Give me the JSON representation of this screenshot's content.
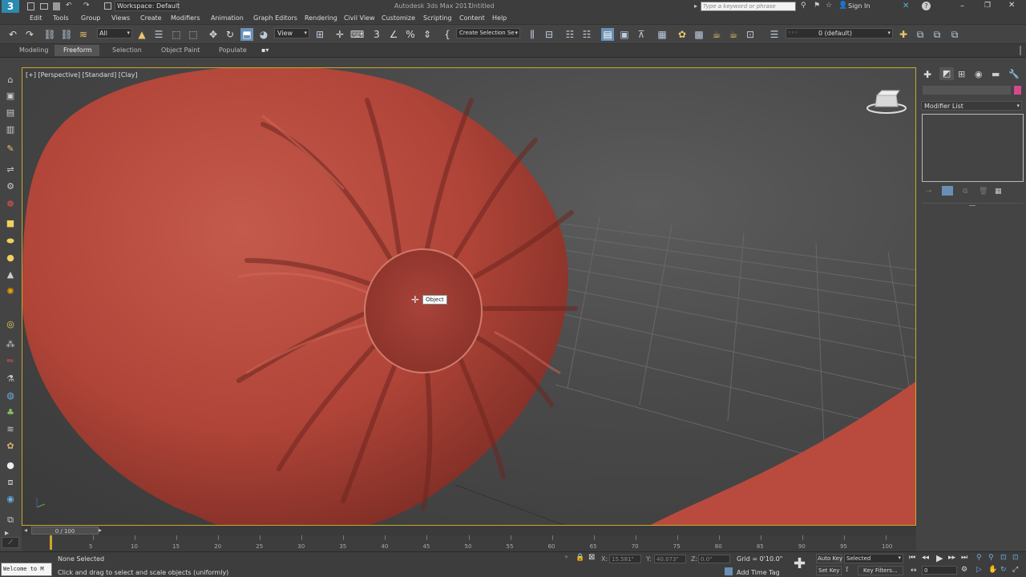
{
  "titlebar": {
    "workspace": "Workspace: Default",
    "app_title": "Autodesk 3ds Max 2017",
    "doc_title": "Untitled",
    "search_placeholder": "Type a keyword or phrase",
    "sign_in": "Sign In"
  },
  "menu": [
    "Edit",
    "Tools",
    "Group",
    "Views",
    "Create",
    "Modifiers",
    "Animation",
    "Graph Editors",
    "Rendering",
    "Civil View",
    "Customize",
    "Scripting",
    "Content",
    "Help"
  ],
  "toolbar": {
    "filter_value": "All",
    "refcoord_value": "View",
    "selection_set_placeholder": "Create Selection Se",
    "layer_value": "0 (default)"
  },
  "ribbon_tabs": [
    "Modeling",
    "Freeform",
    "Selection",
    "Object Paint",
    "Populate"
  ],
  "viewport": {
    "label": "[+] [Perspective] [Standard] [Clay]",
    "tooltip": "Object"
  },
  "command_panel": {
    "modifier_list": "Modifier List",
    "accent_color": "#d34a8c"
  },
  "timeslider": {
    "frame_label": "0 / 100"
  },
  "trackbar": {
    "ticks": [
      "5",
      "10",
      "15",
      "20",
      "25",
      "30",
      "35",
      "40",
      "45",
      "50",
      "55",
      "60",
      "65",
      "70",
      "75",
      "80",
      "85",
      "90",
      "95",
      "100"
    ]
  },
  "status": {
    "maxscript": "Welcome to M",
    "selection": "None Selected",
    "prompt": "Click and drag to select and scale objects (uniformly)",
    "x_label": "X:",
    "x_value": "15.581\"",
    "y_label": "Y:",
    "y_value": "40.073\"",
    "z_label": "Z:",
    "z_value": "0.0\"",
    "grid": "Grid = 0'10.0\"",
    "add_time_tag": "Add Time Tag",
    "auto_key": "Auto Key",
    "set_key": "Set Key",
    "selected": "Selected",
    "key_filters": "Key Filters...",
    "frame": "0"
  },
  "colors": {
    "clay": "#b4473c",
    "viewport_border": "#c8a82a"
  }
}
